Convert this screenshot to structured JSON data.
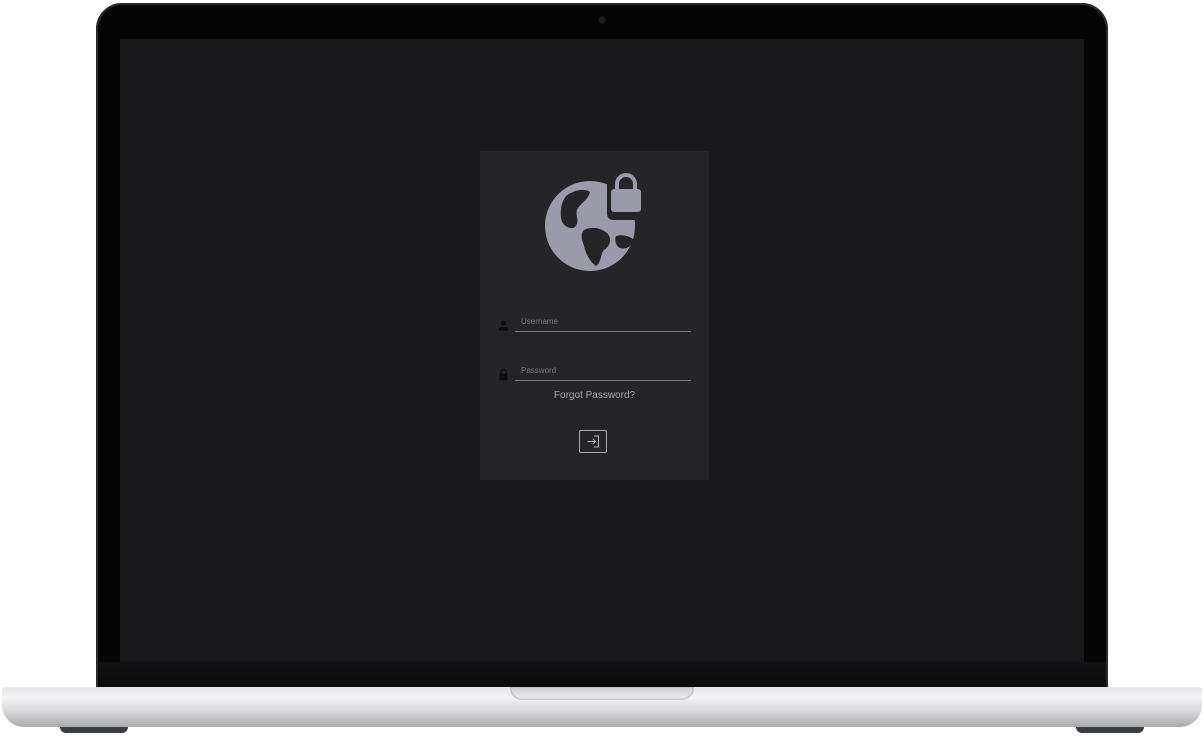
{
  "login": {
    "username_placeholder": "Username",
    "password_placeholder": "Password",
    "forgot_password_label": "Forgot Password?",
    "sign_in_icon": "login-arrow-icon",
    "logo_icon": "globe-lock-icon",
    "username_icon": "person-icon",
    "password_icon": "lock-icon"
  },
  "colors": {
    "screen_background": "#19191b",
    "card_background": "#252527",
    "accent": "#9a9aab"
  }
}
